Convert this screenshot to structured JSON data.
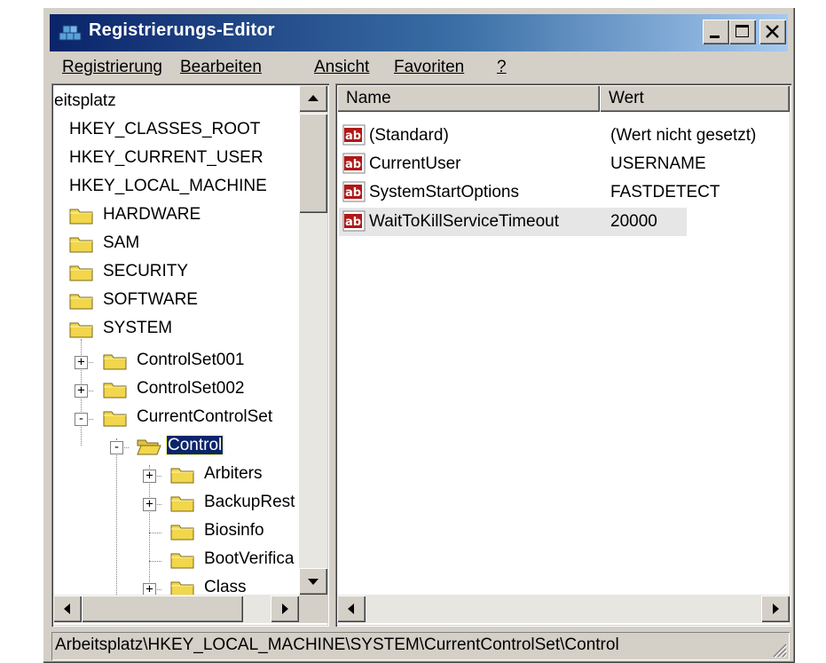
{
  "window": {
    "title": "Registrierungs-Editor",
    "icon": "registry-editor-icon",
    "caption_buttons": [
      "minimize-icon",
      "maximize-icon",
      "close-icon"
    ]
  },
  "menu": {
    "items": [
      "Registrierung",
      "Bearbeiten",
      "Ansicht",
      "Favoriten",
      "?"
    ]
  },
  "tree": {
    "items": [
      {
        "label": "eitsplatz",
        "level": 0,
        "icon": "none"
      },
      {
        "label": "HKEY_CLASSES_ROOT",
        "level": 0,
        "icon": "none"
      },
      {
        "label": "HKEY_CURRENT_USER",
        "level": 0,
        "icon": "none"
      },
      {
        "label": "HKEY_LOCAL_MACHINE",
        "level": 0,
        "icon": "none"
      },
      {
        "label": "HARDWARE",
        "level": 1,
        "icon": "folder-icon"
      },
      {
        "label": "SAM",
        "level": 1,
        "icon": "folder-icon"
      },
      {
        "label": "SECURITY",
        "level": 1,
        "icon": "folder-icon"
      },
      {
        "label": "SOFTWARE",
        "level": 1,
        "icon": "folder-icon"
      },
      {
        "label": "SYSTEM",
        "level": 1,
        "icon": "folder-icon"
      },
      {
        "label": "ControlSet001",
        "level": 2,
        "icon": "folder-icon",
        "expander": "+"
      },
      {
        "label": "ControlSet002",
        "level": 2,
        "icon": "folder-icon",
        "expander": "+"
      },
      {
        "label": "CurrentControlSet",
        "level": 2,
        "icon": "folder-icon",
        "expander": "-"
      },
      {
        "label": "Control",
        "level": 3,
        "icon": "open-folder-icon",
        "expander": "-",
        "selected": true
      },
      {
        "label": "Arbiters",
        "level": 4,
        "icon": "folder-icon",
        "expander": "+"
      },
      {
        "label": "BackupRest",
        "level": 4,
        "icon": "folder-icon",
        "expander": "+"
      },
      {
        "label": "Biosinfo",
        "level": 4,
        "icon": "folder-icon"
      },
      {
        "label": "BootVerifica",
        "level": 4,
        "icon": "folder-icon"
      },
      {
        "label": "Class",
        "level": 4,
        "icon": "folder-icon",
        "expander": "+"
      }
    ]
  },
  "list": {
    "columns": [
      "Name",
      "Wert"
    ],
    "rows": [
      {
        "name": "(Standard)",
        "value": "(Wert nicht gesetzt)",
        "icon": "string-value-icon"
      },
      {
        "name": "CurrentUser",
        "value": "USERNAME",
        "icon": "string-value-icon"
      },
      {
        "name": "SystemStartOptions",
        "value": "FASTDETECT",
        "icon": "string-value-icon"
      },
      {
        "name": "WaitToKillServiceTimeout",
        "value": "20000",
        "icon": "string-value-icon",
        "highlighted": true
      }
    ]
  },
  "status": {
    "path": "Arbeitsplatz\\HKEY_LOCAL_MACHINE\\SYSTEM\\CurrentControlSet\\Control"
  },
  "colors": {
    "title_active": "#0a246a",
    "title_gradient_end": "#a6caf0",
    "face": "#d4d0c8",
    "folder_yellow": "#f2d64b",
    "ab_icon_red": "#b01818"
  }
}
